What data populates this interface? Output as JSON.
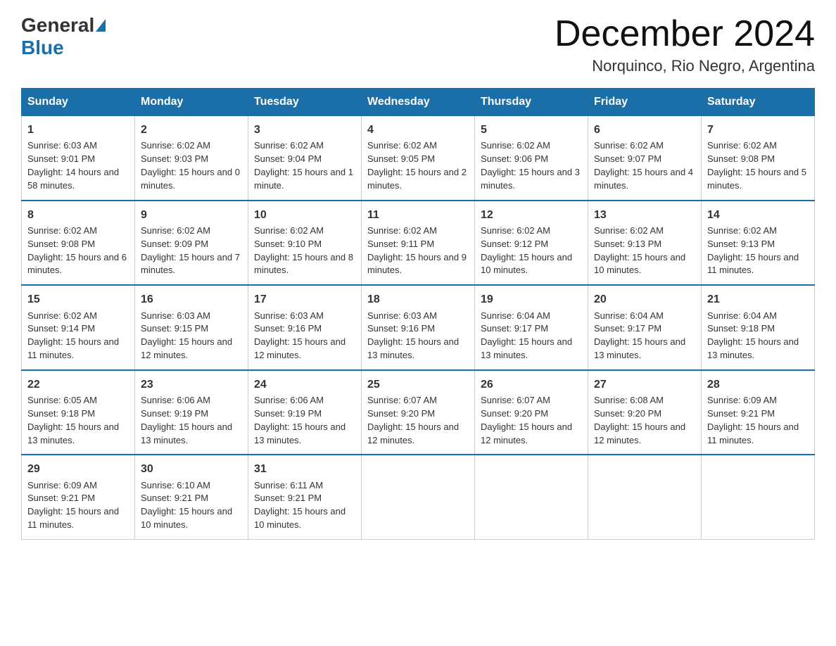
{
  "logo": {
    "general": "General",
    "blue": "Blue"
  },
  "title": "December 2024",
  "location": "Norquinco, Rio Negro, Argentina",
  "days_of_week": [
    "Sunday",
    "Monday",
    "Tuesday",
    "Wednesday",
    "Thursday",
    "Friday",
    "Saturday"
  ],
  "weeks": [
    [
      {
        "day": "1",
        "sunrise": "6:03 AM",
        "sunset": "9:01 PM",
        "daylight": "14 hours and 58 minutes."
      },
      {
        "day": "2",
        "sunrise": "6:02 AM",
        "sunset": "9:03 PM",
        "daylight": "15 hours and 0 minutes."
      },
      {
        "day": "3",
        "sunrise": "6:02 AM",
        "sunset": "9:04 PM",
        "daylight": "15 hours and 1 minute."
      },
      {
        "day": "4",
        "sunrise": "6:02 AM",
        "sunset": "9:05 PM",
        "daylight": "15 hours and 2 minutes."
      },
      {
        "day": "5",
        "sunrise": "6:02 AM",
        "sunset": "9:06 PM",
        "daylight": "15 hours and 3 minutes."
      },
      {
        "day": "6",
        "sunrise": "6:02 AM",
        "sunset": "9:07 PM",
        "daylight": "15 hours and 4 minutes."
      },
      {
        "day": "7",
        "sunrise": "6:02 AM",
        "sunset": "9:08 PM",
        "daylight": "15 hours and 5 minutes."
      }
    ],
    [
      {
        "day": "8",
        "sunrise": "6:02 AM",
        "sunset": "9:08 PM",
        "daylight": "15 hours and 6 minutes."
      },
      {
        "day": "9",
        "sunrise": "6:02 AM",
        "sunset": "9:09 PM",
        "daylight": "15 hours and 7 minutes."
      },
      {
        "day": "10",
        "sunrise": "6:02 AM",
        "sunset": "9:10 PM",
        "daylight": "15 hours and 8 minutes."
      },
      {
        "day": "11",
        "sunrise": "6:02 AM",
        "sunset": "9:11 PM",
        "daylight": "15 hours and 9 minutes."
      },
      {
        "day": "12",
        "sunrise": "6:02 AM",
        "sunset": "9:12 PM",
        "daylight": "15 hours and 10 minutes."
      },
      {
        "day": "13",
        "sunrise": "6:02 AM",
        "sunset": "9:13 PM",
        "daylight": "15 hours and 10 minutes."
      },
      {
        "day": "14",
        "sunrise": "6:02 AM",
        "sunset": "9:13 PM",
        "daylight": "15 hours and 11 minutes."
      }
    ],
    [
      {
        "day": "15",
        "sunrise": "6:02 AM",
        "sunset": "9:14 PM",
        "daylight": "15 hours and 11 minutes."
      },
      {
        "day": "16",
        "sunrise": "6:03 AM",
        "sunset": "9:15 PM",
        "daylight": "15 hours and 12 minutes."
      },
      {
        "day": "17",
        "sunrise": "6:03 AM",
        "sunset": "9:16 PM",
        "daylight": "15 hours and 12 minutes."
      },
      {
        "day": "18",
        "sunrise": "6:03 AM",
        "sunset": "9:16 PM",
        "daylight": "15 hours and 13 minutes."
      },
      {
        "day": "19",
        "sunrise": "6:04 AM",
        "sunset": "9:17 PM",
        "daylight": "15 hours and 13 minutes."
      },
      {
        "day": "20",
        "sunrise": "6:04 AM",
        "sunset": "9:17 PM",
        "daylight": "15 hours and 13 minutes."
      },
      {
        "day": "21",
        "sunrise": "6:04 AM",
        "sunset": "9:18 PM",
        "daylight": "15 hours and 13 minutes."
      }
    ],
    [
      {
        "day": "22",
        "sunrise": "6:05 AM",
        "sunset": "9:18 PM",
        "daylight": "15 hours and 13 minutes."
      },
      {
        "day": "23",
        "sunrise": "6:06 AM",
        "sunset": "9:19 PM",
        "daylight": "15 hours and 13 minutes."
      },
      {
        "day": "24",
        "sunrise": "6:06 AM",
        "sunset": "9:19 PM",
        "daylight": "15 hours and 13 minutes."
      },
      {
        "day": "25",
        "sunrise": "6:07 AM",
        "sunset": "9:20 PM",
        "daylight": "15 hours and 12 minutes."
      },
      {
        "day": "26",
        "sunrise": "6:07 AM",
        "sunset": "9:20 PM",
        "daylight": "15 hours and 12 minutes."
      },
      {
        "day": "27",
        "sunrise": "6:08 AM",
        "sunset": "9:20 PM",
        "daylight": "15 hours and 12 minutes."
      },
      {
        "day": "28",
        "sunrise": "6:09 AM",
        "sunset": "9:21 PM",
        "daylight": "15 hours and 11 minutes."
      }
    ],
    [
      {
        "day": "29",
        "sunrise": "6:09 AM",
        "sunset": "9:21 PM",
        "daylight": "15 hours and 11 minutes."
      },
      {
        "day": "30",
        "sunrise": "6:10 AM",
        "sunset": "9:21 PM",
        "daylight": "15 hours and 10 minutes."
      },
      {
        "day": "31",
        "sunrise": "6:11 AM",
        "sunset": "9:21 PM",
        "daylight": "15 hours and 10 minutes."
      },
      null,
      null,
      null,
      null
    ]
  ],
  "sunrise_label": "Sunrise:",
  "sunset_label": "Sunset:",
  "daylight_label": "Daylight:"
}
